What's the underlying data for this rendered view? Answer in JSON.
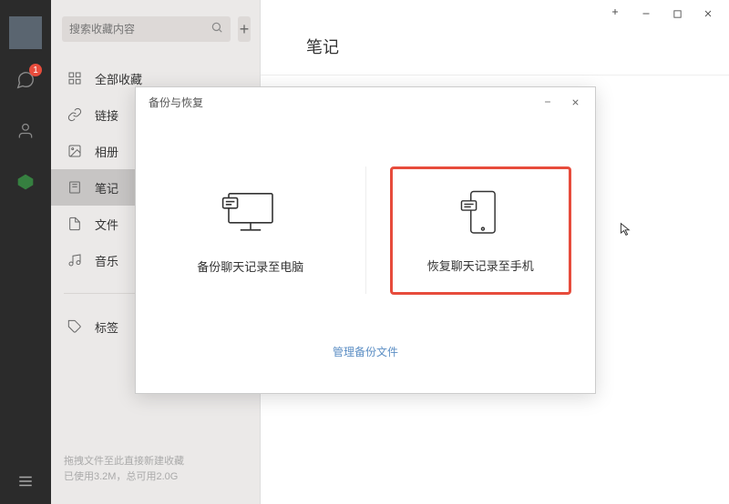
{
  "leftbar": {
    "badge": "1"
  },
  "sidebar": {
    "search_placeholder": "搜索收藏内容",
    "categories": [
      {
        "label": "全部收藏"
      },
      {
        "label": "链接"
      },
      {
        "label": "相册"
      },
      {
        "label": "笔记"
      },
      {
        "label": "文件"
      },
      {
        "label": "音乐"
      }
    ],
    "tag_label": "标签",
    "footer_line1": "拖拽文件至此直接新建收藏",
    "footer_line2": "已使用3.2M，总可用2.0G"
  },
  "main": {
    "title": "笔记"
  },
  "modal": {
    "title": "备份与恢复",
    "option_backup": "备份聊天记录至电脑",
    "option_restore": "恢复聊天记录至手机",
    "manage_link": "管理备份文件"
  }
}
